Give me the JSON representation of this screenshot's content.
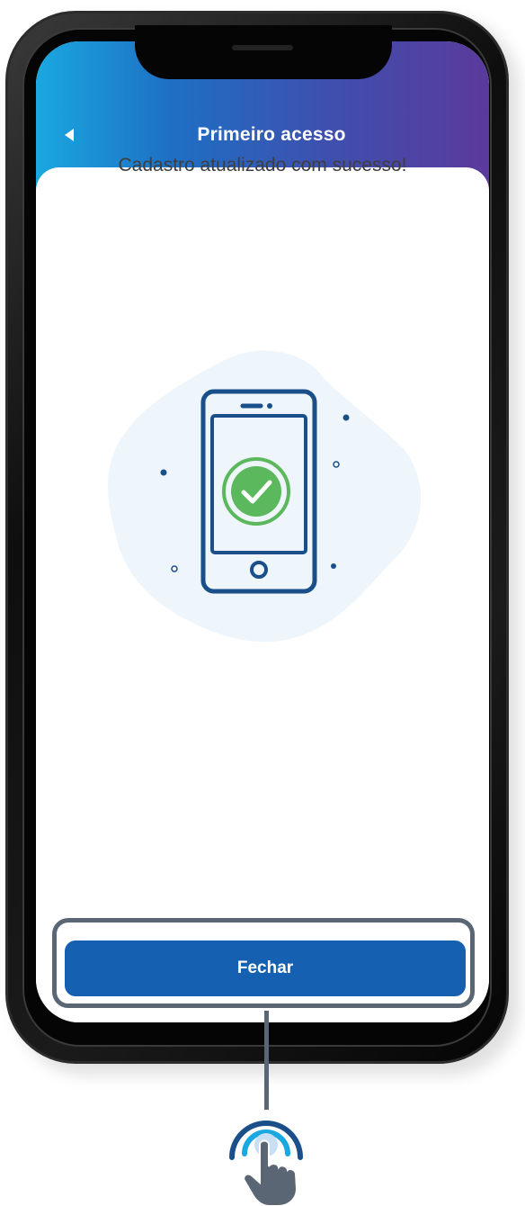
{
  "header": {
    "title": "Primeiro acesso",
    "back_icon": "back-arrow-icon"
  },
  "main": {
    "message": "Cadastro atualizado com sucesso!",
    "illustration_icon": "phone-success-check-icon"
  },
  "footer": {
    "close_label": "Fechar"
  },
  "overlay": {
    "tap_icon": "tap-hand-icon"
  },
  "colors": {
    "header_gradient_start": "#1aa8e0",
    "header_gradient_end": "#5a3a9c",
    "button": "#1560b1",
    "success_green": "#5cb85c",
    "illustration_blue": "#1b4f8a",
    "highlight_gray": "#5a6673"
  }
}
